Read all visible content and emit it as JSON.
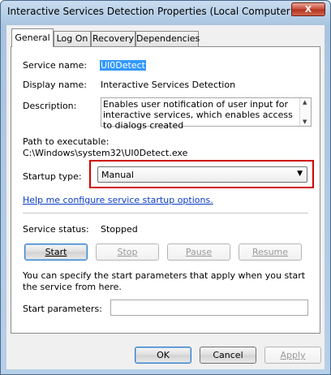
{
  "window": {
    "title": "Interactive Services Detection Properties (Local Computer)",
    "close_glyph": "X"
  },
  "tabs": [
    {
      "label": "General",
      "active": true
    },
    {
      "label": "Log On",
      "active": false
    },
    {
      "label": "Recovery",
      "active": false
    },
    {
      "label": "Dependencies",
      "active": false
    }
  ],
  "general": {
    "service_name_label": "Service name:",
    "service_name": "UI0Detect",
    "display_name_label": "Display name:",
    "display_name": "Interactive Services Detection",
    "description_label": "Description:",
    "description": "Enables user notification of user input for interactive services, which enables access to dialogs created",
    "path_label": "Path to executable:",
    "path": "C:\\Windows\\system32\\UI0Detect.exe",
    "startup_type_label": "Startup type:",
    "startup_type": "Manual",
    "help_link": "Help me configure service startup options.",
    "status_label": "Service status:",
    "status": "Stopped",
    "buttons": {
      "start": "Start",
      "stop": "Stop",
      "pause": "Pause",
      "resume": "Resume"
    },
    "params_note": "You can specify the start parameters that apply when you start the service from here.",
    "params_label": "Start parameters:",
    "params_value": ""
  },
  "footer": {
    "ok": "OK",
    "cancel": "Cancel",
    "apply": "Apply"
  },
  "colors": {
    "highlight_box": "#d00000",
    "link": "#0a3cc8",
    "selection": "#3399ff"
  },
  "icons": {
    "close": "close-icon",
    "dropdown": "chevron-down-icon",
    "scroll_up": "scroll-up-icon",
    "scroll_down": "scroll-down-icon"
  }
}
